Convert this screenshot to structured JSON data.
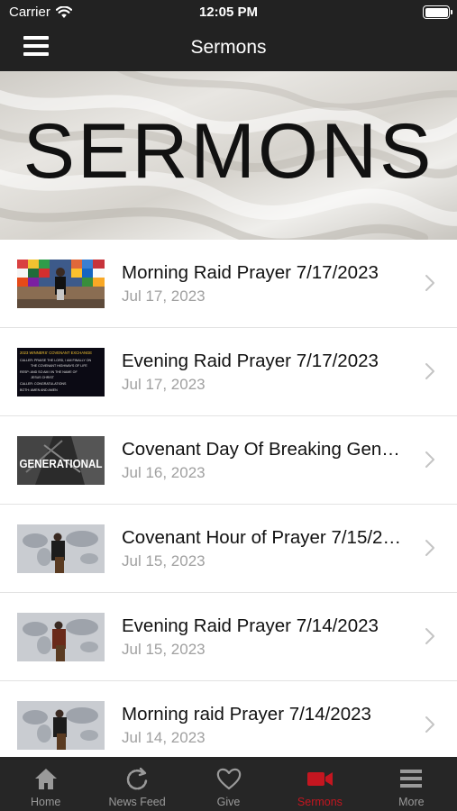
{
  "status_bar": {
    "carrier": "Carrier",
    "time": "12:05 PM"
  },
  "nav": {
    "title": "Sermons"
  },
  "banner": {
    "text": "SERMONS"
  },
  "sermons": [
    {
      "title": "Morning Raid Prayer 7/17/2023",
      "date": "Jul 17, 2023",
      "thumb": "preacher-flags"
    },
    {
      "title": "Evening Raid Prayer 7/17/2023",
      "date": "Jul 17, 2023",
      "thumb": "covenant-exchange-text"
    },
    {
      "title": "Covenant Day Of Breaking Gen…",
      "date": "Jul 16, 2023",
      "thumb": "generational-graphic"
    },
    {
      "title": "Covenant Hour of Prayer 7/15/2…",
      "date": "Jul 15, 2023",
      "thumb": "preacher-map"
    },
    {
      "title": "Evening Raid Prayer 7/14/2023",
      "date": "Jul 15, 2023",
      "thumb": "preacher-map"
    },
    {
      "title": "Morning raid Prayer 7/14/2023",
      "date": "Jul 14, 2023",
      "thumb": "preacher-map"
    }
  ],
  "thumb_texts": {
    "exchange_lines": [
      "2023 WINNERS' COVENANT EXCHANGE",
      "CALLER: PRAISE THE LORD, I AM FINALLY ON",
      "THE COVENANT HIGHWAYS OF LIFE",
      "RESP: AND SO AM I IN THE NAME OF",
      "JESUS CHRIST",
      "CALLER: CONGRATULATIONS",
      "BOTH: AMEN AND AMEN"
    ],
    "generational": "GENERATIONAL"
  },
  "tabs": [
    {
      "label": "Home",
      "icon": "home-icon"
    },
    {
      "label": "News Feed",
      "icon": "refresh-icon"
    },
    {
      "label": "Give",
      "icon": "heart-icon"
    },
    {
      "label": "Sermons",
      "icon": "video-camera-icon",
      "active": true
    },
    {
      "label": "More",
      "icon": "menu-icon"
    }
  ],
  "colors": {
    "bar": "#222222",
    "accent": "#c41620",
    "tab_inactive": "#9a9a9a"
  }
}
